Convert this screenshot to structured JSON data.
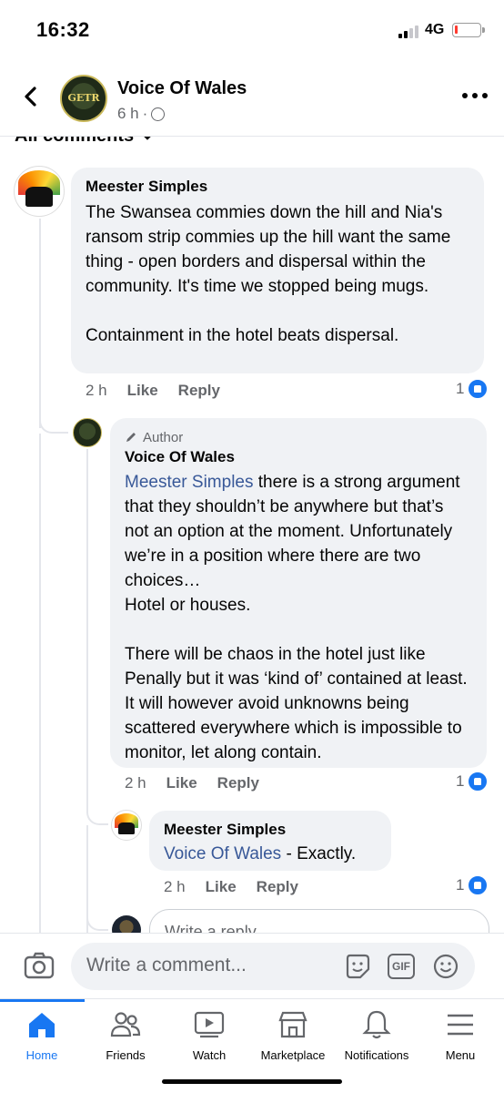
{
  "status_bar": {
    "time": "16:32",
    "network": "4G"
  },
  "header": {
    "page_name": "Voice Of Wales",
    "time": "6 h",
    "meta_sep": "·",
    "avatar_text": "GETR"
  },
  "filter": {
    "label": "All comments"
  },
  "comments": [
    {
      "author": "Meester Simples",
      "text": "The Swansea commies down the hill and Nia's ransom strip commies up the hill want the same thing - open borders and dispersal within the community.  It's time we stopped being mugs.\n\nContainment in the hotel beats dispersal.",
      "time": "2 h",
      "like": "Like",
      "reply": "Reply",
      "reactions": "1"
    },
    {
      "author_tag": "Author",
      "author": "Voice Of Wales",
      "mention": "Meester Simples",
      "text": " there is a strong argument that they shouldn’t be anywhere but that’s not an option at the moment. Unfortunately we’re in a position where there are two choices…\nHotel or houses.\n\nThere will be chaos in the hotel just like Penally but it was ‘kind of’ contained at least. It will however avoid unknowns being scattered everywhere which is impossible to monitor, let along contain.",
      "time": "2 h",
      "like": "Like",
      "reply": "Reply",
      "reactions": "1"
    },
    {
      "author": "Meester Simples",
      "mention": "Voice Of Wales",
      "text": " - Exactly.",
      "time": "2 h",
      "like": "Like",
      "reply": "Reply",
      "reactions": "1"
    }
  ],
  "reply_input": {
    "placeholder": "Write a reply..."
  },
  "composer": {
    "placeholder": "Write a comment...",
    "gif": "GIF"
  },
  "nav": {
    "items": [
      {
        "label": "Home",
        "icon": "home-icon",
        "active": true
      },
      {
        "label": "Friends",
        "icon": "friends-icon"
      },
      {
        "label": "Watch",
        "icon": "watch-icon"
      },
      {
        "label": "Marketplace",
        "icon": "marketplace-icon"
      },
      {
        "label": "Notifications",
        "icon": "bell-icon"
      },
      {
        "label": "Menu",
        "icon": "menu-icon"
      }
    ]
  },
  "colors": {
    "accent": "#1877f2",
    "mention": "#385898",
    "bubble": "#f0f2f5",
    "secondary_text": "#65676b"
  }
}
